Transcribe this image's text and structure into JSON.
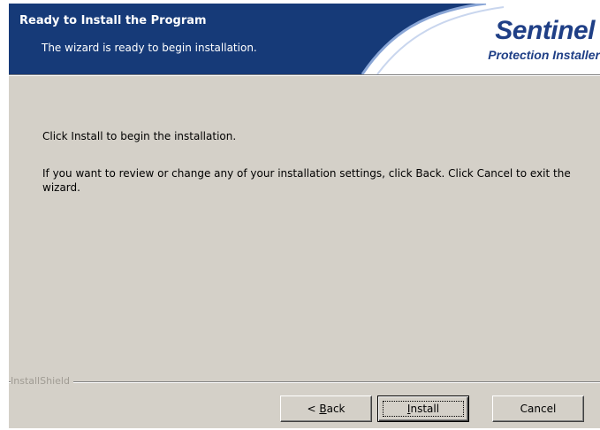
{
  "header": {
    "title": "Ready to Install the Program",
    "subtitle": "The wizard is ready to begin installation.",
    "logo_text": "Sentinel",
    "logo_subtext": "Protection Installer"
  },
  "main": {
    "paragraph_1": "Click Install to begin the installation.",
    "paragraph_2": "If you want to review or change any of your installation settings, click Back. Click Cancel to exit the wizard."
  },
  "footer": {
    "brand_label": "InstallShield"
  },
  "buttons": {
    "back": {
      "prefix": "< ",
      "mnemonic": "B",
      "rest": "ack"
    },
    "install": {
      "mnemonic": "I",
      "rest": "nstall"
    },
    "cancel": "Cancel"
  },
  "colors": {
    "banner": "#163a78",
    "dialog_bg": "#d4d0c8",
    "logo": "#1f3f86"
  }
}
